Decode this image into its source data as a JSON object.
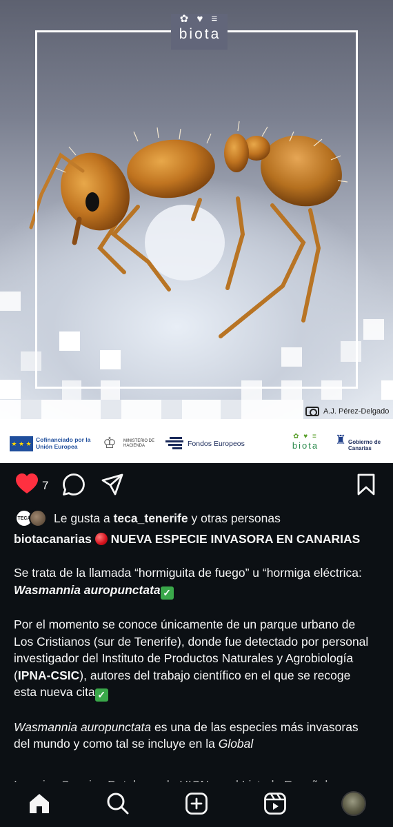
{
  "post_image": {
    "brand_glyphs": "✿ ♥ ≡",
    "brand_word": "biota",
    "photo_credit": "A.J. Pérez-Delgado",
    "logos": {
      "eu": "Cofinanciado por la Unión Europea",
      "ministry": "MINISTERIO DE HACIENDA",
      "fondos": "Fondos Europeos",
      "biota": "biota",
      "canarias": "Gobierno de Canarias"
    }
  },
  "actions": {
    "like_count": "7",
    "icons": [
      "heart-filled-icon",
      "comment-icon",
      "share-icon",
      "bookmark-icon"
    ],
    "like_color": "#ff3040"
  },
  "likes": {
    "prefix": "Le gusta a",
    "user": "teca_tenerife",
    "suffix": "y otras personas",
    "avatar1_text": "TECA"
  },
  "caption": {
    "username": "biotacanarias",
    "headline": "NUEVA ESPECIE INVASORA EN CANARIAS",
    "p1_text": "Se trata de la llamada “hormiguita de fuego” u “hormiga eléctrica: ",
    "p1_species": "Wasmannia auropunctata",
    "p2_text_a": "Por el momento se conoce únicamente de un parque urbano de Los Cristianos (sur de Tenerife), donde fue detectado por personal investigador del Instituto de Productos Naturales y Agrobiología (",
    "p2_bold": "IPNA-CSIC",
    "p2_text_b": "), autores del trabajo científico en el que se recoge esta nueva cita",
    "p3_species": "Wasmannia auropunctata",
    "p3_text": " es una de las especies más invasoras del mundo y como tal se incluye en la ",
    "p3_italic": "Global",
    "cut_line": "Invasive Species Database de UICN en el Listado Español"
  },
  "bottom_nav": [
    "home-icon",
    "search-icon",
    "create-icon",
    "reels-icon",
    "profile-avatar"
  ]
}
